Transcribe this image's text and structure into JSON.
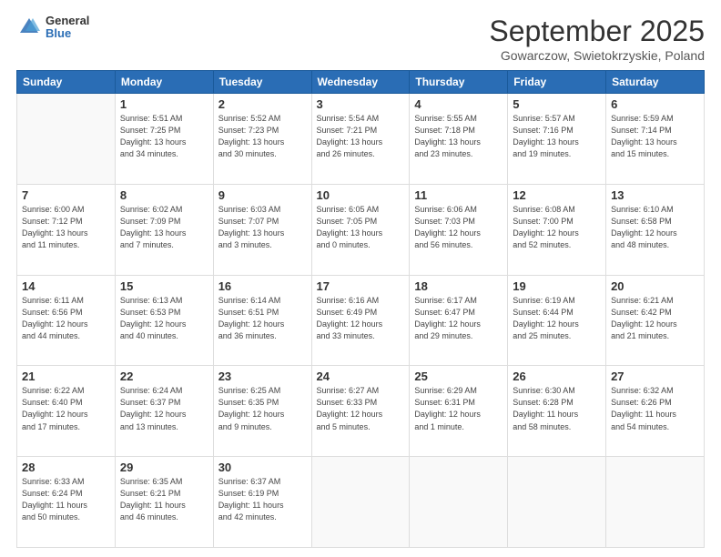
{
  "logo": {
    "general": "General",
    "blue": "Blue"
  },
  "header": {
    "title": "September 2025",
    "subtitle": "Gowarczow, Swietokrzyskie, Poland"
  },
  "days_of_week": [
    "Sunday",
    "Monday",
    "Tuesday",
    "Wednesday",
    "Thursday",
    "Friday",
    "Saturday"
  ],
  "weeks": [
    [
      {
        "day": "",
        "info": ""
      },
      {
        "day": "1",
        "info": "Sunrise: 5:51 AM\nSunset: 7:25 PM\nDaylight: 13 hours\nand 34 minutes."
      },
      {
        "day": "2",
        "info": "Sunrise: 5:52 AM\nSunset: 7:23 PM\nDaylight: 13 hours\nand 30 minutes."
      },
      {
        "day": "3",
        "info": "Sunrise: 5:54 AM\nSunset: 7:21 PM\nDaylight: 13 hours\nand 26 minutes."
      },
      {
        "day": "4",
        "info": "Sunrise: 5:55 AM\nSunset: 7:18 PM\nDaylight: 13 hours\nand 23 minutes."
      },
      {
        "day": "5",
        "info": "Sunrise: 5:57 AM\nSunset: 7:16 PM\nDaylight: 13 hours\nand 19 minutes."
      },
      {
        "day": "6",
        "info": "Sunrise: 5:59 AM\nSunset: 7:14 PM\nDaylight: 13 hours\nand 15 minutes."
      }
    ],
    [
      {
        "day": "7",
        "info": "Sunrise: 6:00 AM\nSunset: 7:12 PM\nDaylight: 13 hours\nand 11 minutes."
      },
      {
        "day": "8",
        "info": "Sunrise: 6:02 AM\nSunset: 7:09 PM\nDaylight: 13 hours\nand 7 minutes."
      },
      {
        "day": "9",
        "info": "Sunrise: 6:03 AM\nSunset: 7:07 PM\nDaylight: 13 hours\nand 3 minutes."
      },
      {
        "day": "10",
        "info": "Sunrise: 6:05 AM\nSunset: 7:05 PM\nDaylight: 13 hours\nand 0 minutes."
      },
      {
        "day": "11",
        "info": "Sunrise: 6:06 AM\nSunset: 7:03 PM\nDaylight: 12 hours\nand 56 minutes."
      },
      {
        "day": "12",
        "info": "Sunrise: 6:08 AM\nSunset: 7:00 PM\nDaylight: 12 hours\nand 52 minutes."
      },
      {
        "day": "13",
        "info": "Sunrise: 6:10 AM\nSunset: 6:58 PM\nDaylight: 12 hours\nand 48 minutes."
      }
    ],
    [
      {
        "day": "14",
        "info": "Sunrise: 6:11 AM\nSunset: 6:56 PM\nDaylight: 12 hours\nand 44 minutes."
      },
      {
        "day": "15",
        "info": "Sunrise: 6:13 AM\nSunset: 6:53 PM\nDaylight: 12 hours\nand 40 minutes."
      },
      {
        "day": "16",
        "info": "Sunrise: 6:14 AM\nSunset: 6:51 PM\nDaylight: 12 hours\nand 36 minutes."
      },
      {
        "day": "17",
        "info": "Sunrise: 6:16 AM\nSunset: 6:49 PM\nDaylight: 12 hours\nand 33 minutes."
      },
      {
        "day": "18",
        "info": "Sunrise: 6:17 AM\nSunset: 6:47 PM\nDaylight: 12 hours\nand 29 minutes."
      },
      {
        "day": "19",
        "info": "Sunrise: 6:19 AM\nSunset: 6:44 PM\nDaylight: 12 hours\nand 25 minutes."
      },
      {
        "day": "20",
        "info": "Sunrise: 6:21 AM\nSunset: 6:42 PM\nDaylight: 12 hours\nand 21 minutes."
      }
    ],
    [
      {
        "day": "21",
        "info": "Sunrise: 6:22 AM\nSunset: 6:40 PM\nDaylight: 12 hours\nand 17 minutes."
      },
      {
        "day": "22",
        "info": "Sunrise: 6:24 AM\nSunset: 6:37 PM\nDaylight: 12 hours\nand 13 minutes."
      },
      {
        "day": "23",
        "info": "Sunrise: 6:25 AM\nSunset: 6:35 PM\nDaylight: 12 hours\nand 9 minutes."
      },
      {
        "day": "24",
        "info": "Sunrise: 6:27 AM\nSunset: 6:33 PM\nDaylight: 12 hours\nand 5 minutes."
      },
      {
        "day": "25",
        "info": "Sunrise: 6:29 AM\nSunset: 6:31 PM\nDaylight: 12 hours\nand 1 minute."
      },
      {
        "day": "26",
        "info": "Sunrise: 6:30 AM\nSunset: 6:28 PM\nDaylight: 11 hours\nand 58 minutes."
      },
      {
        "day": "27",
        "info": "Sunrise: 6:32 AM\nSunset: 6:26 PM\nDaylight: 11 hours\nand 54 minutes."
      }
    ],
    [
      {
        "day": "28",
        "info": "Sunrise: 6:33 AM\nSunset: 6:24 PM\nDaylight: 11 hours\nand 50 minutes."
      },
      {
        "day": "29",
        "info": "Sunrise: 6:35 AM\nSunset: 6:21 PM\nDaylight: 11 hours\nand 46 minutes."
      },
      {
        "day": "30",
        "info": "Sunrise: 6:37 AM\nSunset: 6:19 PM\nDaylight: 11 hours\nand 42 minutes."
      },
      {
        "day": "",
        "info": ""
      },
      {
        "day": "",
        "info": ""
      },
      {
        "day": "",
        "info": ""
      },
      {
        "day": "",
        "info": ""
      }
    ]
  ]
}
